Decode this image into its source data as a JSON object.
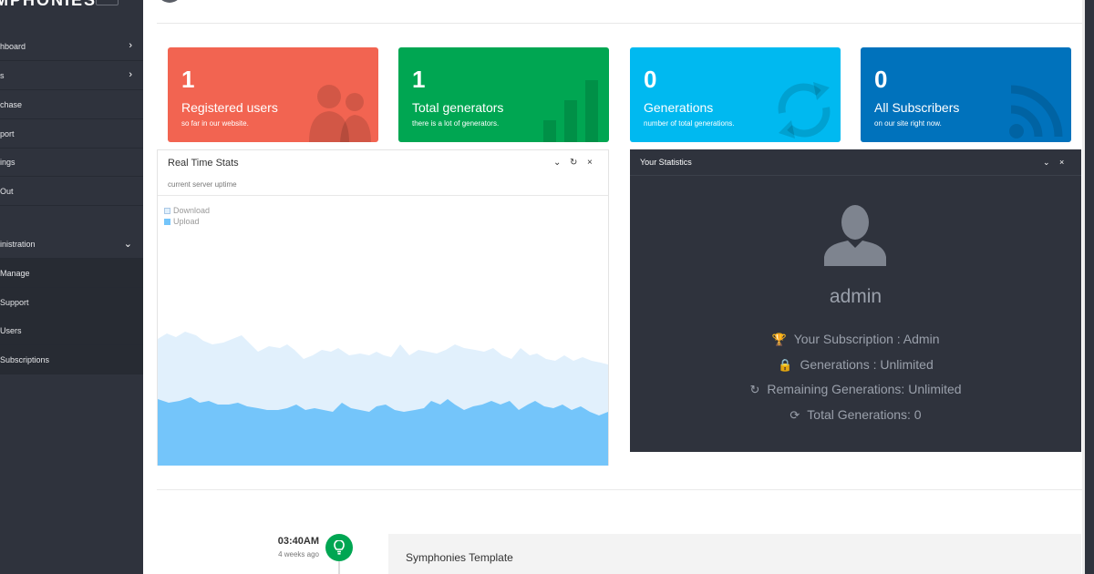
{
  "sidebar": {
    "brand": "MPHONIES",
    "items": [
      {
        "label": "hboard",
        "chevron": "›"
      },
      {
        "label": "s",
        "chevron": "›"
      },
      {
        "label": "chase"
      },
      {
        "label": "port"
      },
      {
        "label": "ings"
      },
      {
        "label": "Out"
      }
    ],
    "admin_section": {
      "label": "inistration",
      "chevron": "⌄"
    },
    "admin_items": [
      {
        "label": "Manage"
      },
      {
        "label": "Support"
      },
      {
        "label": "Users"
      },
      {
        "label": "Subscriptions"
      }
    ]
  },
  "cards": [
    {
      "value": "1",
      "title": "Registered users",
      "subtitle": "so far in our website.",
      "color": "#f26451",
      "icon": "users-icon"
    },
    {
      "value": "1",
      "title": "Total generators",
      "subtitle": "there is a lot of generators.",
      "color": "#00a652",
      "icon": "bar-chart-icon"
    },
    {
      "value": "0",
      "title": "Generations",
      "subtitle": "number of total generations.",
      "color": "#00b9f0",
      "icon": "refresh-icon"
    },
    {
      "value": "0",
      "title": "All Subscribers",
      "subtitle": "on our site right now.",
      "color": "#0072bc",
      "icon": "rss-icon"
    }
  ],
  "realtime": {
    "title": "Real Time Stats",
    "subtitle": "current server uptime",
    "legend": [
      "Download",
      "Upload"
    ],
    "controls": {
      "collapse": "⌄",
      "refresh": "↻",
      "close": "×"
    }
  },
  "stats": {
    "title": "Your Statistics",
    "username": "admin",
    "rows": [
      {
        "icon": "trophy-icon",
        "glyph": "🏆",
        "text": "Your Subscription : Admin"
      },
      {
        "icon": "lock-icon",
        "glyph": "🔒",
        "text": "Generations : Unlimited"
      },
      {
        "icon": "redo-icon",
        "glyph": "↻",
        "text": "Remaining Generations: Unlimited"
      },
      {
        "icon": "sync-icon",
        "glyph": "⟳",
        "text": "Total Generations: 0"
      }
    ],
    "controls": {
      "collapse": "⌄",
      "close": "×"
    }
  },
  "timeline": {
    "time": "03:40AM",
    "ago": "4 weeks ago",
    "icon": "lightbulb-icon",
    "entry_title": "Symphonies Template"
  },
  "colors": {
    "sidebar_bg": "#2f333d",
    "download_area": "#e1f0fc",
    "upload_area": "#74c5fa",
    "timeline_dot": "#00a652"
  }
}
